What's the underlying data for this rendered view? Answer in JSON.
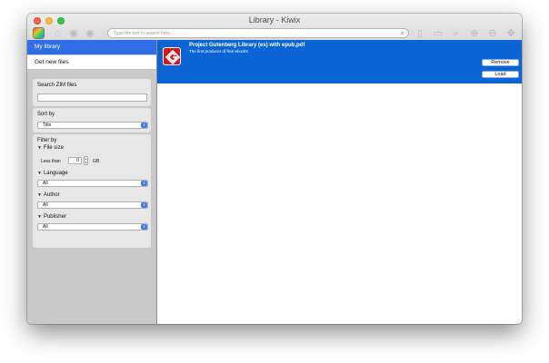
{
  "window": {
    "title": "Library - Kiwix",
    "search_placeholder": "Type the text to search here..."
  },
  "toolbar": {
    "icons": [
      "kiwix-app-icon",
      "home-icon",
      "back-icon",
      "forward-icon",
      "bookmark-icon",
      "print-icon",
      "find-icon",
      "zoom-in-icon",
      "zoom-out-icon",
      "fullscreen-icon"
    ]
  },
  "sidebar": {
    "my_library": "My library",
    "get_new_files": "Get new files",
    "search_zim_label": "Search ZIM files",
    "search_zim_value": "",
    "sort_by_label": "Sort by",
    "sort_by_value": "Title",
    "filter_by_label": "Filter by",
    "file_size_label": "File size",
    "less_than_label": "Less than",
    "file_size_value": "0",
    "file_size_unit": "GB",
    "language_label": "Language",
    "language_value": "All",
    "author_label": "Author",
    "author_value": "All",
    "publisher_label": "Publisher",
    "publisher_value": "All"
  },
  "book": {
    "title": "Project Gutenberg Library (es) with epub,pdf",
    "description": "The first producer of free ebooks",
    "remove_label": "Remove",
    "load_label": "Load"
  },
  "colors": {
    "selection_blue": "#0a64d4",
    "sidebar_selected": "#2f6ee4",
    "icon_red": "#d2191f"
  }
}
